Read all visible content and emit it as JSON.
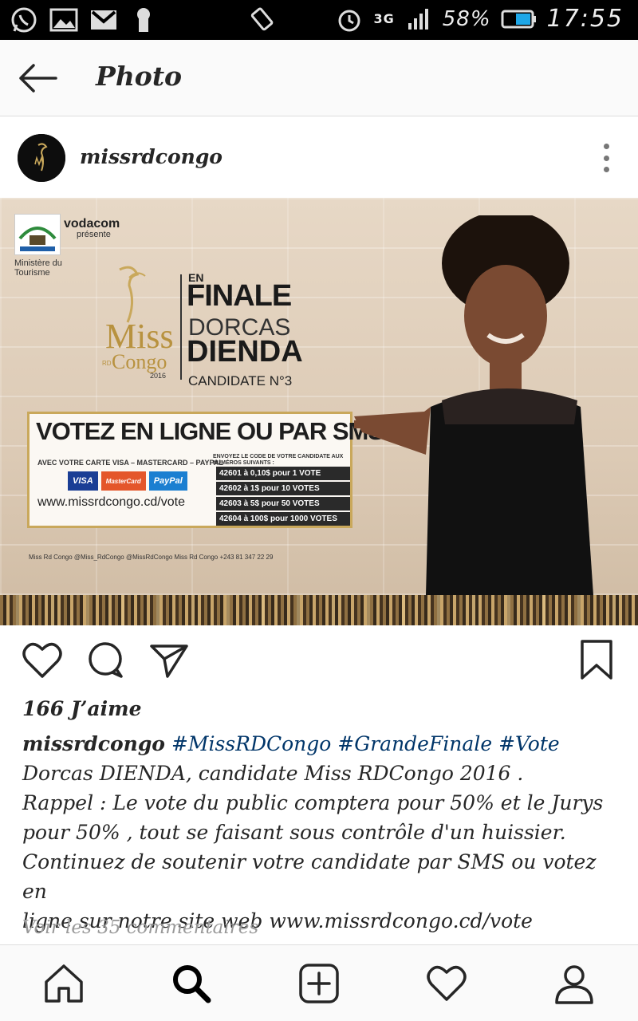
{
  "status_bar": {
    "battery": "58%",
    "network": "3G",
    "time": "17:55",
    "icons": [
      "whatsapp-icon",
      "gallery-icon",
      "gmail-icon",
      "keyhole-icon",
      "rotate-icon",
      "alarm-icon",
      "signal-icon",
      "battery-icon"
    ]
  },
  "header": {
    "title": "Photo"
  },
  "post": {
    "username": "missrdcongo",
    "likes": "166 J’aime",
    "caption": {
      "user": "missrdcongo",
      "tags": [
        "#MissRDCongo",
        "#GrandeFinale",
        "#Vote"
      ],
      "lines": [
        "Dorcas DIENDA, candidate Miss RDCongo 2016 .",
        "Rappel : Le vote du public comptera pour 50% et le Jurys",
        "pour 50% , tout se faisant sous contrôle d'un huissier.",
        "Continuez de soutenir votre candidate par SMS ou votez en",
        "ligne sur notre site web www.missrdcongo.cd/vote"
      ]
    },
    "view_comments": "Voir les 35 commentaires"
  },
  "poster": {
    "ministry": "Ministère du Tourisme",
    "sponsor": "vodacom",
    "sponsor_sub": "présente",
    "logo_text": "Miss RD Congo",
    "logo_year": "2016",
    "en": "EN",
    "finale": "FINALE",
    "first_name": "DORCAS",
    "last_name": "DIENDA",
    "candidate": "CANDIDATE N°3",
    "vote_title": "VOTEZ EN LIGNE OU PAR SMS",
    "card_text": "AVEC VOTRE CARTE VISA – MASTERCARD – PAYPAL",
    "cards": [
      "VISA",
      "MasterCard",
      "PayPal"
    ],
    "vote_url": "www.missrdcongo.cd/vote",
    "sms_head": "ENVOYEZ LE CODE DE VOTRE CANDIDATE AUX NUMÉROS SUIVANTS :",
    "sms_rows": [
      "42601 à 0,10$ pour 1 VOTE",
      "42602 à 1$ pour 10 VOTES",
      "42603 à 5$ pour 50 VOTES",
      "42604 à 100$ pour 1000 VOTES"
    ],
    "socials": "Miss Rd Congo   @Miss_RdCongo   @MissRdCongo   Miss Rd Congo   +243 81 347 22 29"
  },
  "colors": {
    "accent": "#003569",
    "text": "#262626",
    "muted": "#999999",
    "gold": "#c9a85b"
  }
}
